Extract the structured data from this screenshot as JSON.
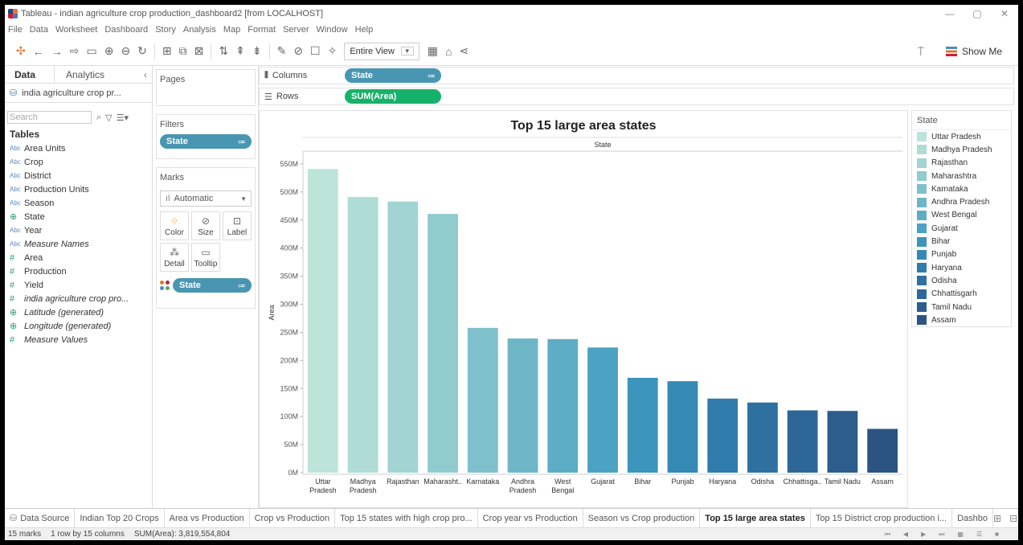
{
  "window": {
    "title": "Tableau - indian agriculture crop production_dashboard2 [from LOCALHOST]",
    "controls": [
      "—",
      "▢",
      "✕"
    ]
  },
  "menu": [
    "File",
    "Data",
    "Worksheet",
    "Dashboard",
    "Story",
    "Analysis",
    "Map",
    "Format",
    "Server",
    "Window",
    "Help"
  ],
  "toolbar": {
    "fit_value": "Entire View",
    "show_me_label": "Show Me"
  },
  "data_pane": {
    "tab_data": "Data",
    "tab_analytics": "Analytics",
    "datasource": "india agriculture crop pr...",
    "search_placeholder": "Search",
    "tables_label": "Tables",
    "fields": [
      {
        "type": "Abc",
        "name": "Area Units",
        "italic": false
      },
      {
        "type": "Abc",
        "name": "Crop",
        "italic": false
      },
      {
        "type": "Abc",
        "name": "District",
        "italic": false
      },
      {
        "type": "Abc",
        "name": "Production Units",
        "italic": false
      },
      {
        "type": "Abc",
        "name": "Season",
        "italic": false
      },
      {
        "type": "globe",
        "name": "State",
        "italic": false
      },
      {
        "type": "Abc",
        "name": "Year",
        "italic": false
      },
      {
        "type": "Abc",
        "name": "Measure Names",
        "italic": true
      },
      {
        "type": "#",
        "name": "Area",
        "italic": false
      },
      {
        "type": "#",
        "name": "Production",
        "italic": false
      },
      {
        "type": "#",
        "name": "Yield",
        "italic": false
      },
      {
        "type": "#",
        "name": "india agriculture crop pro...",
        "italic": true
      },
      {
        "type": "globe",
        "name": "Latitude (generated)",
        "italic": true
      },
      {
        "type": "globe",
        "name": "Longitude (generated)",
        "italic": true
      },
      {
        "type": "#",
        "name": "Measure Values",
        "italic": true
      }
    ]
  },
  "cards": {
    "pages": "Pages",
    "filters": "Filters",
    "filter_pill": "State",
    "marks": "Marks",
    "mark_type": "Automatic",
    "buttons": [
      "Color",
      "Size",
      "Label",
      "Detail",
      "Tooltip"
    ],
    "marks_pill": "State"
  },
  "shelves": {
    "columns_label": "Columns",
    "columns_pill": "State",
    "rows_label": "Rows",
    "rows_pill": "SUM(Area)"
  },
  "chart_data": {
    "type": "bar",
    "title": "Top 15 large area states",
    "header": "State",
    "ylabel": "Area",
    "ylim": [
      0,
      570000000
    ],
    "yticks": [
      "0M",
      "50M",
      "100M",
      "150M",
      "200M",
      "250M",
      "300M",
      "350M",
      "400M",
      "450M",
      "500M",
      "550M"
    ],
    "categories": [
      [
        "Uttar",
        "Pradesh"
      ],
      [
        "Madhya",
        "Pradesh"
      ],
      [
        "Rajasthan"
      ],
      [
        "Maharasht.."
      ],
      [
        "Karnataka"
      ],
      [
        "Andhra",
        "Pradesh"
      ],
      [
        "West",
        "Bengal"
      ],
      [
        "Gujarat"
      ],
      [
        "Bihar"
      ],
      [
        "Punjab"
      ],
      [
        "Haryana"
      ],
      [
        "Odisha"
      ],
      [
        "Chhattisga.."
      ],
      [
        "Tamil Nadu"
      ],
      [
        "Assam"
      ]
    ],
    "values": [
      541000000,
      491000000,
      483000000,
      461000000,
      258000000,
      239000000,
      238000000,
      223000000,
      169000000,
      163000000,
      132000000,
      125000000,
      111000000,
      110000000,
      78000000
    ],
    "colors": [
      "#bce4d8",
      "#afdcd5",
      "#a1d4d2",
      "#90cbce",
      "#7ec0cb",
      "#6db6c8",
      "#5dadc6",
      "#4ca2c3",
      "#3c95bd",
      "#3489b5",
      "#307cac",
      "#2e71a1",
      "#2d6797",
      "#2c5d8d",
      "#2b5483"
    ]
  },
  "legend": {
    "title": "State",
    "items": [
      "Uttar Pradesh",
      "Madhya Pradesh",
      "Rajasthan",
      "Maharashtra",
      "Karnataka",
      "Andhra Pradesh",
      "West Bengal",
      "Gujarat",
      "Bihar",
      "Punjab",
      "Haryana",
      "Odisha",
      "Chhattisgarh",
      "Tamil Nadu",
      "Assam"
    ]
  },
  "sheet_tabs": {
    "data_source": "Data Source",
    "tabs": [
      "Indian Top 20 Crops",
      "Area vs Production",
      "Crop vs Production",
      "Top 15 states with high crop pro...",
      "Crop year vs Production",
      "Season vs Crop production",
      "Top 15 large area states",
      "Top 15 District crop production i...",
      "Dashbo"
    ],
    "active_index": 6
  },
  "status": {
    "marks": "15 marks",
    "layout": "1 row by 15 columns",
    "sum": "SUM(Area): 3,819,554,804"
  }
}
